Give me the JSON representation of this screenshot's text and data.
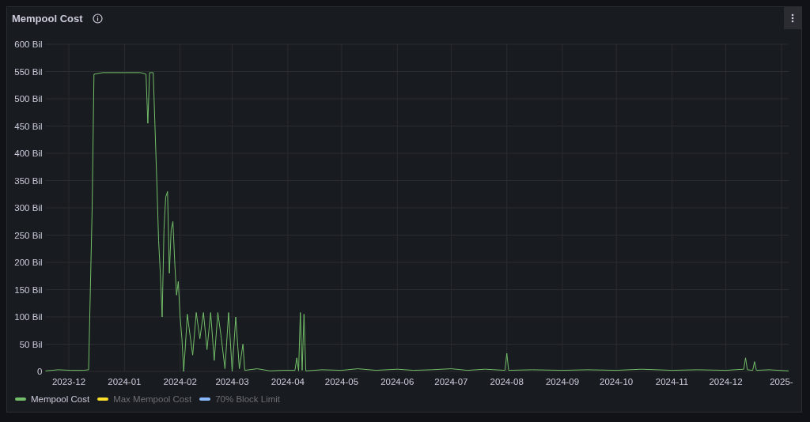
{
  "panel": {
    "title": "Mempool Cost",
    "menu": {
      "kind": "menu"
    },
    "chart_data": {
      "type": "line",
      "grid": true,
      "xlim": [
        "2023-11-18",
        "2025-01-05"
      ],
      "ylim": [
        0,
        600
      ],
      "yticks": [
        {
          "value": 0,
          "label": "0"
        },
        {
          "value": 50,
          "label": "50 Bil"
        },
        {
          "value": 100,
          "label": "100 Bil"
        },
        {
          "value": 150,
          "label": "150 Bil"
        },
        {
          "value": 200,
          "label": "200 Bil"
        },
        {
          "value": 250,
          "label": "250 Bil"
        },
        {
          "value": 300,
          "label": "300 Bil"
        },
        {
          "value": 350,
          "label": "350 Bil"
        },
        {
          "value": 400,
          "label": "400 Bil"
        },
        {
          "value": 450,
          "label": "450 Bil"
        },
        {
          "value": 500,
          "label": "500 Bil"
        },
        {
          "value": 550,
          "label": "550 Bil"
        },
        {
          "value": 600,
          "label": "600 Bil"
        }
      ],
      "xticks": [
        {
          "value": "2023-12-01",
          "label": "2023-12"
        },
        {
          "value": "2024-01-01",
          "label": "2024-01"
        },
        {
          "value": "2024-02-01",
          "label": "2024-02"
        },
        {
          "value": "2024-03-01",
          "label": "2024-03"
        },
        {
          "value": "2024-04-01",
          "label": "2024-04"
        },
        {
          "value": "2024-05-01",
          "label": "2024-05"
        },
        {
          "value": "2024-06-01",
          "label": "2024-06"
        },
        {
          "value": "2024-07-01",
          "label": "2024-07"
        },
        {
          "value": "2024-08-01",
          "label": "2024-08"
        },
        {
          "value": "2024-09-01",
          "label": "2024-09"
        },
        {
          "value": "2024-10-01",
          "label": "2024-10"
        },
        {
          "value": "2024-11-01",
          "label": "2024-11"
        },
        {
          "value": "2024-12-01",
          "label": "2024-12"
        },
        {
          "value": "2025-01-01",
          "label": "2025-"
        }
      ],
      "x": [
        "2023-11-18",
        "2023-11-25",
        "2023-12-02",
        "2023-12-09",
        "2023-12-12",
        "2023-12-14",
        "2023-12-15",
        "2023-12-20",
        "2024-01-01",
        "2024-01-10",
        "2024-01-13",
        "2024-01-14",
        "2024-01-15",
        "2024-01-17",
        "2024-01-19",
        "2024-01-20",
        "2024-01-21",
        "2024-01-22",
        "2024-01-23",
        "2024-01-24",
        "2024-01-25",
        "2024-01-26",
        "2024-01-27",
        "2024-01-28",
        "2024-01-29",
        "2024-01-30",
        "2024-01-31",
        "2024-02-01",
        "2024-02-02",
        "2024-02-03",
        "2024-02-04",
        "2024-02-05",
        "2024-02-06",
        "2024-02-08",
        "2024-02-10",
        "2024-02-12",
        "2024-02-14",
        "2024-02-16",
        "2024-02-18",
        "2024-02-20",
        "2024-02-22",
        "2024-02-24",
        "2024-02-26",
        "2024-02-28",
        "2024-03-01",
        "2024-03-03",
        "2024-03-05",
        "2024-03-07",
        "2024-03-08",
        "2024-03-15",
        "2024-03-22",
        "2024-03-29",
        "2024-04-05",
        "2024-04-06",
        "2024-04-07",
        "2024-04-08",
        "2024-04-09",
        "2024-04-10",
        "2024-04-11",
        "2024-04-20",
        "2024-05-01",
        "2024-05-10",
        "2024-05-20",
        "2024-06-01",
        "2024-06-10",
        "2024-06-20",
        "2024-07-01",
        "2024-07-10",
        "2024-07-20",
        "2024-07-31",
        "2024-08-01",
        "2024-08-02",
        "2024-08-15",
        "2024-09-01",
        "2024-09-15",
        "2024-10-01",
        "2024-10-15",
        "2024-11-01",
        "2024-11-15",
        "2024-12-01",
        "2024-12-11",
        "2024-12-12",
        "2024-12-13",
        "2024-12-16",
        "2024-12-17",
        "2024-12-18",
        "2024-12-25",
        "2025-01-05"
      ],
      "series": [
        {
          "name": "Mempool Cost",
          "color": "#73bf69",
          "values": [
            1,
            3,
            2,
            2,
            3,
            300,
            545,
            548,
            548,
            548,
            545,
            455,
            548,
            548,
            350,
            240,
            180,
            100,
            260,
            320,
            330,
            180,
            260,
            275,
            200,
            140,
            165,
            100,
            60,
            0,
            50,
            105,
            80,
            30,
            108,
            60,
            108,
            40,
            108,
            20,
            108,
            60,
            5,
            108,
            0,
            100,
            5,
            50,
            2,
            5,
            1,
            2,
            2,
            25,
            1,
            108,
            2,
            105,
            1,
            3,
            2,
            5,
            2,
            4,
            2,
            3,
            5,
            2,
            4,
            2,
            33,
            2,
            3,
            2,
            3,
            2,
            4,
            2,
            3,
            2,
            4,
            25,
            3,
            2,
            18,
            2,
            3,
            1
          ]
        },
        {
          "name": "Max Mempool Cost",
          "color": "#fade2a",
          "values": [
            null,
            null,
            null,
            null,
            null,
            null,
            null,
            null,
            null,
            null,
            null,
            null,
            null,
            null,
            null,
            null,
            null,
            null,
            null,
            null,
            null,
            null,
            null,
            null,
            null,
            null,
            null,
            null,
            null,
            null,
            null,
            null,
            null,
            null,
            null,
            null,
            null,
            null,
            null,
            null,
            null,
            null,
            null,
            null,
            null,
            null,
            null,
            null,
            null,
            null,
            null,
            null,
            null,
            null,
            null,
            null,
            null,
            null,
            null,
            null,
            null,
            null,
            null,
            null,
            null,
            null,
            null,
            null,
            null,
            null,
            null,
            null,
            null,
            null,
            null,
            null,
            null,
            null,
            null,
            null,
            null,
            null,
            null,
            null,
            null,
            null,
            null,
            null
          ]
        },
        {
          "name": "70% Block Limit",
          "color": "#8ab8ff",
          "values": [
            null,
            null,
            null,
            null,
            null,
            null,
            null,
            null,
            null,
            null,
            null,
            null,
            null,
            null,
            null,
            null,
            null,
            null,
            null,
            null,
            null,
            null,
            null,
            null,
            null,
            null,
            null,
            null,
            null,
            null,
            null,
            null,
            null,
            null,
            null,
            null,
            null,
            null,
            null,
            null,
            null,
            null,
            null,
            null,
            null,
            null,
            null,
            null,
            null,
            null,
            null,
            null,
            null,
            null,
            null,
            null,
            null,
            null,
            null,
            null,
            null,
            null,
            null,
            null,
            null,
            null,
            null,
            null,
            null,
            null,
            null,
            null,
            null,
            null,
            null,
            null,
            null,
            null,
            null,
            null,
            null,
            null,
            null,
            null,
            null,
            null,
            null,
            null
          ]
        }
      ]
    },
    "legend": [
      {
        "hidden": false
      },
      {
        "hidden": true
      },
      {
        "hidden": true
      }
    ]
  }
}
